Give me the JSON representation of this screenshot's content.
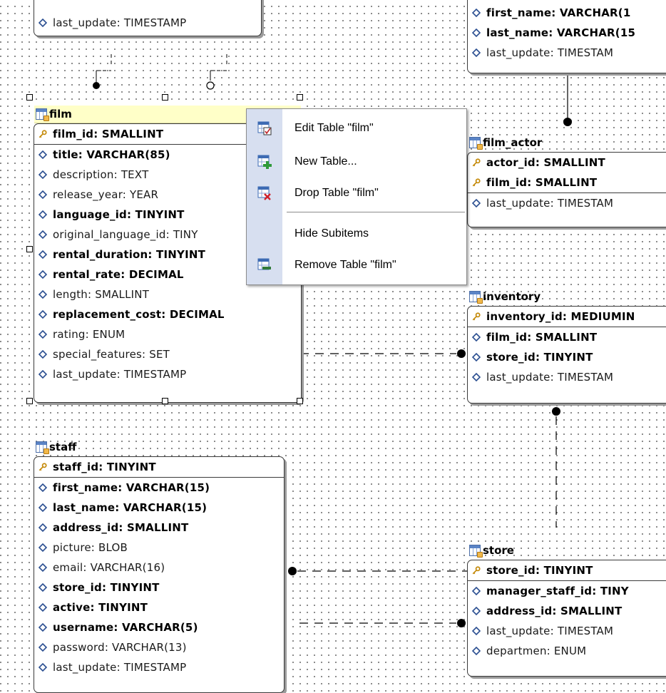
{
  "entities": {
    "actor_top": {
      "rows": [
        {
          "label": "last_update: TIMESTAMP",
          "type": "regular"
        }
      ]
    },
    "customer_top": {
      "rows": [
        {
          "label": "first_name: VARCHAR(1",
          "type": "bold"
        },
        {
          "label": "last_name: VARCHAR(15",
          "type": "bold"
        },
        {
          "label": "last_update: TIMESTAM",
          "type": "regular"
        }
      ]
    },
    "film": {
      "title": "film",
      "rows": [
        {
          "label": "film_id: SMALLINT",
          "type": "pk"
        },
        {
          "label": "title: VARCHAR(85)",
          "type": "bold"
        },
        {
          "label": "description: TEXT",
          "type": "regular"
        },
        {
          "label": "release_year: YEAR",
          "type": "regular"
        },
        {
          "label": "language_id: TINYINT",
          "type": "bold"
        },
        {
          "label": "original_language_id: TINY",
          "type": "regular"
        },
        {
          "label": "rental_duration: TINYINT",
          "type": "bold"
        },
        {
          "label": "rental_rate: DECIMAL",
          "type": "bold"
        },
        {
          "label": "length: SMALLINT",
          "type": "regular"
        },
        {
          "label": "replacement_cost: DECIMAL",
          "type": "bold"
        },
        {
          "label": "rating: ENUM",
          "type": "regular"
        },
        {
          "label": "special_features: SET",
          "type": "regular"
        },
        {
          "label": "last_update: TIMESTAMP",
          "type": "regular"
        }
      ]
    },
    "film_actor": {
      "title": "film_actor",
      "rows": [
        {
          "label": "actor_id: SMALLINT",
          "type": "pk"
        },
        {
          "label": "film_id: SMALLINT",
          "type": "pk"
        },
        {
          "label": "last_update: TIMESTAM",
          "type": "regular"
        }
      ]
    },
    "inventory": {
      "title": "inventory",
      "rows": [
        {
          "label": "inventory_id: MEDIUMIN",
          "type": "pk"
        },
        {
          "label": "film_id: SMALLINT",
          "type": "bold"
        },
        {
          "label": "store_id: TINYINT",
          "type": "bold"
        },
        {
          "label": "last_update: TIMESTAM",
          "type": "regular"
        }
      ]
    },
    "staff": {
      "title": "staff",
      "rows": [
        {
          "label": "staff_id: TINYINT",
          "type": "pk"
        },
        {
          "label": "first_name: VARCHAR(15)",
          "type": "bold"
        },
        {
          "label": "last_name: VARCHAR(15)",
          "type": "bold"
        },
        {
          "label": "address_id: SMALLINT",
          "type": "bold"
        },
        {
          "label": "picture: BLOB",
          "type": "regular"
        },
        {
          "label": "email: VARCHAR(16)",
          "type": "regular"
        },
        {
          "label": "store_id: TINYINT",
          "type": "bold"
        },
        {
          "label": "active: TINYINT",
          "type": "bold"
        },
        {
          "label": "username: VARCHAR(5)",
          "type": "bold"
        },
        {
          "label": "password: VARCHAR(13)",
          "type": "regular"
        },
        {
          "label": "last_update: TIMESTAMP",
          "type": "regular"
        }
      ]
    },
    "store": {
      "title": "store",
      "rows": [
        {
          "label": "store_id: TINYINT",
          "type": "pk"
        },
        {
          "label": "manager_staff_id: TINY",
          "type": "bold"
        },
        {
          "label": "address_id: SMALLINT",
          "type": "bold"
        },
        {
          "label": "last_update: TIMESTAM",
          "type": "regular"
        },
        {
          "label": "departmen: ENUM",
          "type": "regular"
        }
      ]
    }
  },
  "context_menu": {
    "items": [
      {
        "label": "Edit Table \"film\"",
        "icon": "edit-table-icon"
      },
      {
        "label": "New Table...",
        "icon": "new-table-icon"
      },
      {
        "label": "Drop Table \"film\"",
        "icon": "drop-table-icon"
      },
      {
        "label": "Hide Subitems",
        "icon": ""
      },
      {
        "label": "Remove Table \"film\"",
        "icon": "remove-table-icon"
      }
    ]
  },
  "colors": {
    "selected_header": "#ffffc8",
    "menu_gutter": "#d7dff0",
    "field_icon": "#2b4f91",
    "key_icon": "#d9a20f"
  }
}
